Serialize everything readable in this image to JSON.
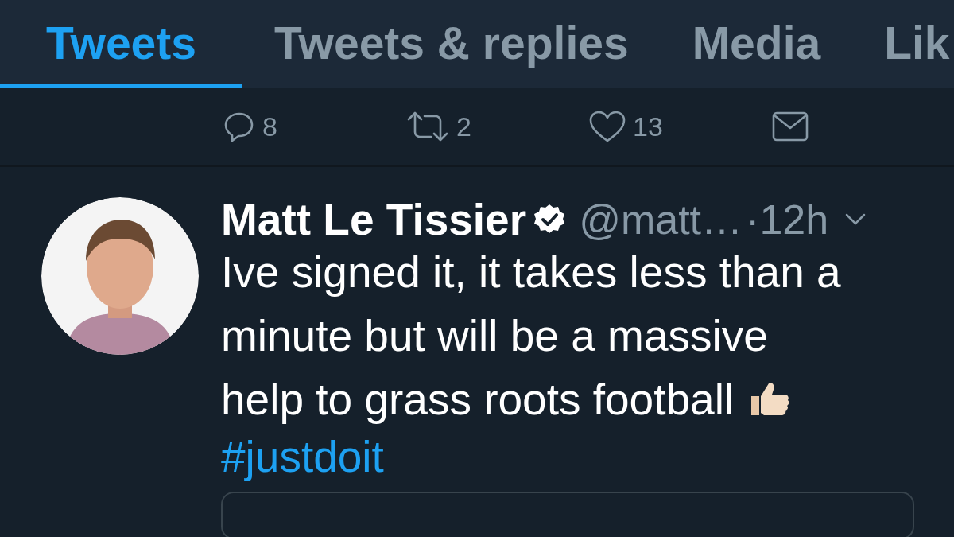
{
  "tabs": [
    {
      "label": "Tweets",
      "selected": true
    },
    {
      "label": "Tweets & replies",
      "selected": false
    },
    {
      "label": "Media",
      "selected": false
    },
    {
      "label": "Lik",
      "selected": false
    }
  ],
  "actions": [
    {
      "kind": "reply",
      "count": "8"
    },
    {
      "kind": "retweet",
      "count": "2"
    },
    {
      "kind": "like",
      "count": "13"
    },
    {
      "kind": "message"
    }
  ],
  "tweet": {
    "name": "Matt Le Tissier",
    "verified": true,
    "handle": "@matt…",
    "separator": "·",
    "time": "12h",
    "text_lines": [
      "Ive signed it, it takes less than a",
      "minute but will be a massive",
      "help to grass roots football"
    ],
    "hashtag": "#justdoit"
  }
}
